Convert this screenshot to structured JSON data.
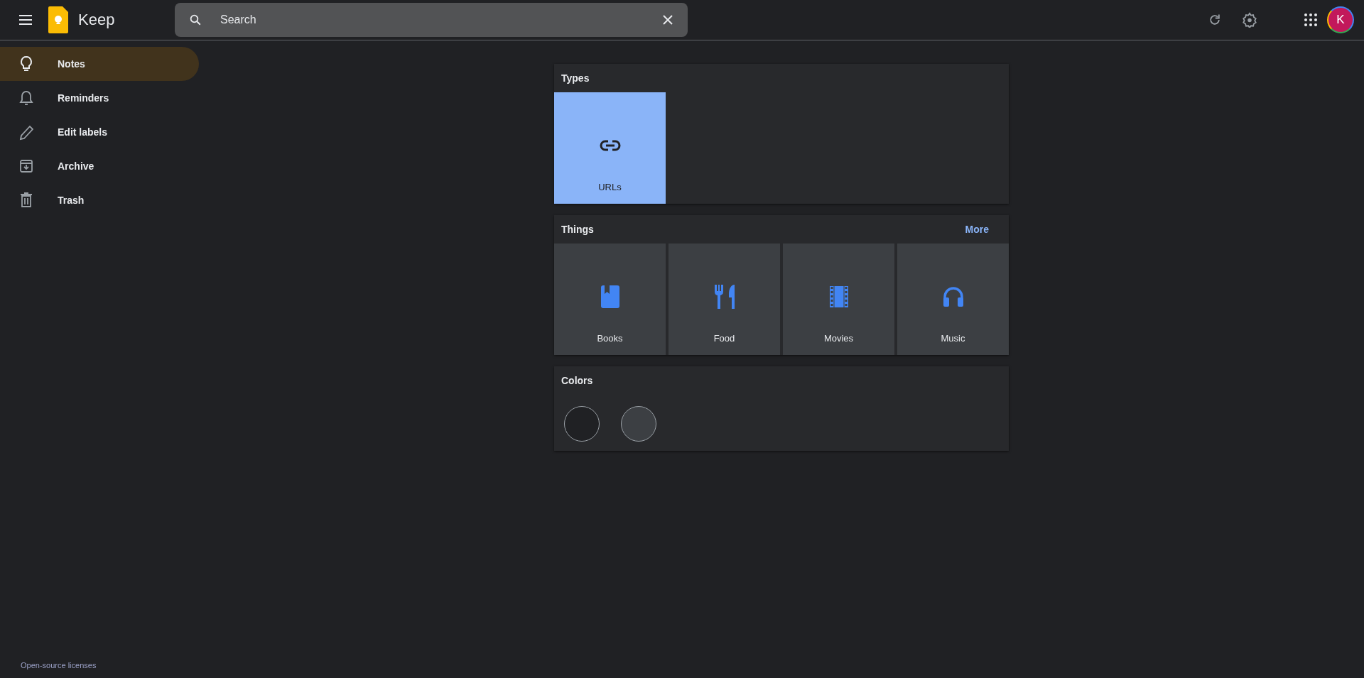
{
  "app": {
    "name": "Keep"
  },
  "search": {
    "placeholder": "Search"
  },
  "account": {
    "initial": "K"
  },
  "sidebar": {
    "items": [
      {
        "label": "Notes",
        "kind": "bulb",
        "selected": true
      },
      {
        "label": "Reminders",
        "kind": "bell",
        "selected": false
      },
      {
        "label": "Edit labels",
        "kind": "pencil",
        "selected": false
      },
      {
        "label": "Archive",
        "kind": "archive",
        "selected": false
      },
      {
        "label": "Trash",
        "kind": "trash",
        "selected": false
      }
    ],
    "footer_link": "Open-source licenses"
  },
  "sections": [
    {
      "kind": "tiles",
      "title": "Types",
      "tiles": [
        {
          "label": "URLs",
          "kind": "link",
          "selected": true
        }
      ]
    },
    {
      "kind": "tiles",
      "title": "Things",
      "more": "More",
      "tiles": [
        {
          "label": "Books",
          "kind": "book",
          "selected": false
        },
        {
          "label": "Food",
          "kind": "food",
          "selected": false
        },
        {
          "label": "Movies",
          "kind": "film",
          "selected": false
        },
        {
          "label": "Music",
          "kind": "headphones",
          "selected": false
        }
      ]
    },
    {
      "kind": "colors",
      "title": "Colors",
      "colors": [
        {
          "color": "#202124"
        },
        {
          "color": "#3c3f43"
        }
      ]
    }
  ]
}
